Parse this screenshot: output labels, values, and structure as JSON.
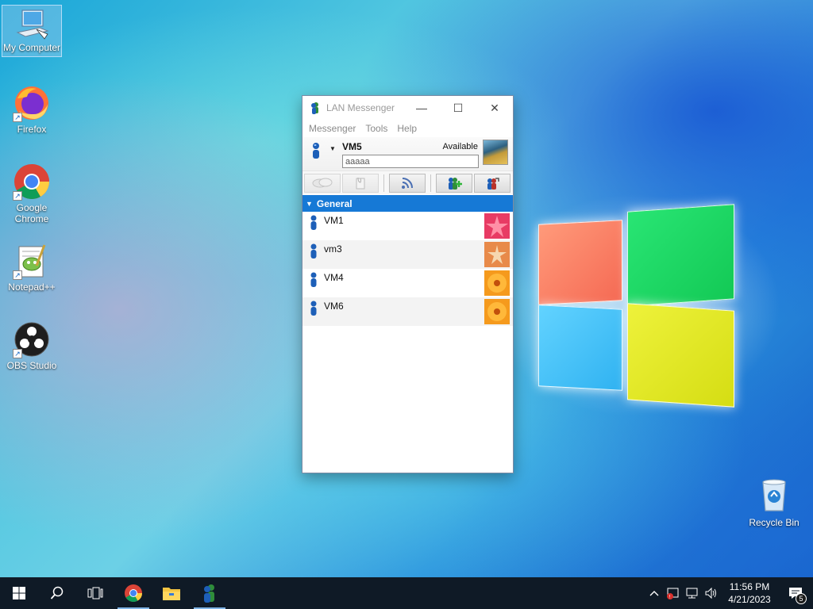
{
  "desktop": {
    "icons": [
      {
        "label": "My Computer",
        "icon": "computer-icon"
      },
      {
        "label": "Firefox",
        "icon": "firefox-icon"
      },
      {
        "label": "Google Chrome",
        "icon": "chrome-icon"
      },
      {
        "label": "Notepad++",
        "icon": "notepadpp-icon"
      },
      {
        "label": "OBS Studio",
        "icon": "obs-icon"
      }
    ],
    "recycle_bin": {
      "label": "Recycle Bin",
      "icon": "recycle-bin-icon"
    }
  },
  "window": {
    "title": "LAN Messenger",
    "controls": {
      "minimize": "—",
      "maximize": "☐",
      "close": "✕"
    },
    "menu": [
      "Messenger",
      "Tools",
      "Help"
    ],
    "profile": {
      "name": "VM5",
      "status": "Available",
      "note": "aaaaa"
    },
    "toolbar": [
      "chat-button",
      "file-transfer-button",
      "broadcast-button",
      "add-contact-button",
      "refresh-contacts-button"
    ],
    "group": {
      "name": "General"
    },
    "contacts": [
      {
        "name": "VM1",
        "avatar": "red-starfish-avatar"
      },
      {
        "name": "vm3",
        "avatar": "starfish-avatar"
      },
      {
        "name": "VM4",
        "avatar": "orange-flower-avatar"
      },
      {
        "name": "VM6",
        "avatar": "orange-flower-avatar"
      }
    ]
  },
  "taskbar": {
    "clock": {
      "time": "11:56 PM",
      "date": "4/21/2023"
    },
    "notification_count": "5"
  },
  "colors": {
    "accent": "#1679d6",
    "taskbar": "#0f1a26"
  }
}
